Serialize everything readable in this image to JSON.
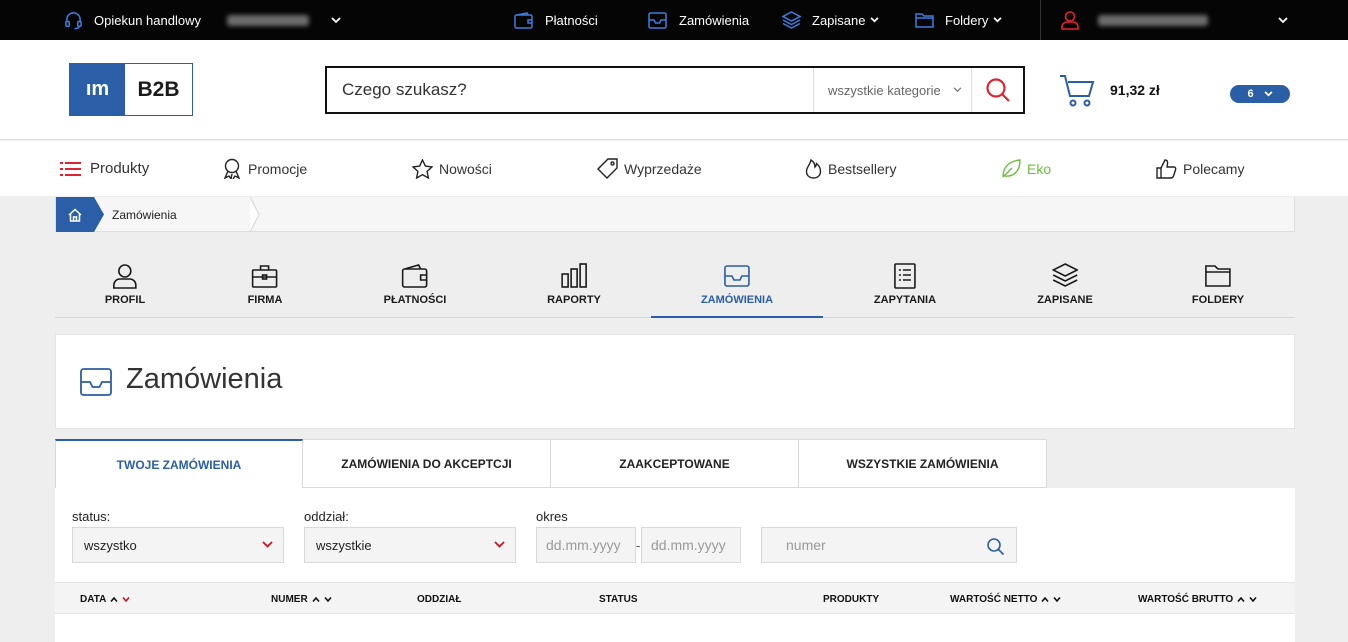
{
  "topbar": {
    "advisor_label": "Opiekun handlowy",
    "payments": "Płatności",
    "orders": "Zamówienia",
    "saved": "Zapisane",
    "folders": "Foldery"
  },
  "logo": {
    "left": "ım",
    "right": "B2B"
  },
  "search": {
    "placeholder": "Czego szukasz?",
    "category": "wszystkie kategorie"
  },
  "cart": {
    "total": "91,32 zł",
    "count": "6"
  },
  "nav": {
    "products": "Produkty",
    "promotions": "Promocje",
    "news": "Nowości",
    "sales": "Wyprzedaże",
    "bestsellers": "Bestsellery",
    "eco": "Eko",
    "recommended": "Polecamy"
  },
  "breadcrumb": {
    "current": "Zamówienia"
  },
  "account_tabs": {
    "profile": "PROFIL",
    "company": "FIRMA",
    "payments": "PŁATNOŚCI",
    "reports": "RAPORTY",
    "orders": "ZAMÓWIENIA",
    "inquiries": "ZAPYTANIA",
    "saved": "ZAPISANE",
    "folders": "FOLDERY"
  },
  "page": {
    "title": "Zamówienia"
  },
  "order_tabs": {
    "mine": "TWOJE ZAMÓWIENIA",
    "to_accept": "ZAMÓWIENIA DO AKCEPTCJI",
    "accepted": "ZAAKCEPTOWANE",
    "all": "WSZYSTKIE ZAMÓWIENIA"
  },
  "filters": {
    "status_label": "status:",
    "status_value": "wszystko",
    "branch_label": "oddział:",
    "branch_value": "wszystkie",
    "period_label": "okres",
    "date_from_placeholder": "dd.mm.yyyy",
    "date_sep": "-",
    "date_to_placeholder": "dd.mm.yyyy",
    "number_placeholder": "numer"
  },
  "table": {
    "date": "DATA",
    "number": "NUMER",
    "branch": "ODDZIAŁ",
    "status": "STATUS",
    "products": "PRODUKTY",
    "net": "WARTOŚĆ NETTO",
    "gross": "WARTOŚĆ BRUTTO"
  },
  "colors": {
    "accent": "#2a5ea6",
    "alert": "#e0242e",
    "eco": "#6bbf3a"
  }
}
